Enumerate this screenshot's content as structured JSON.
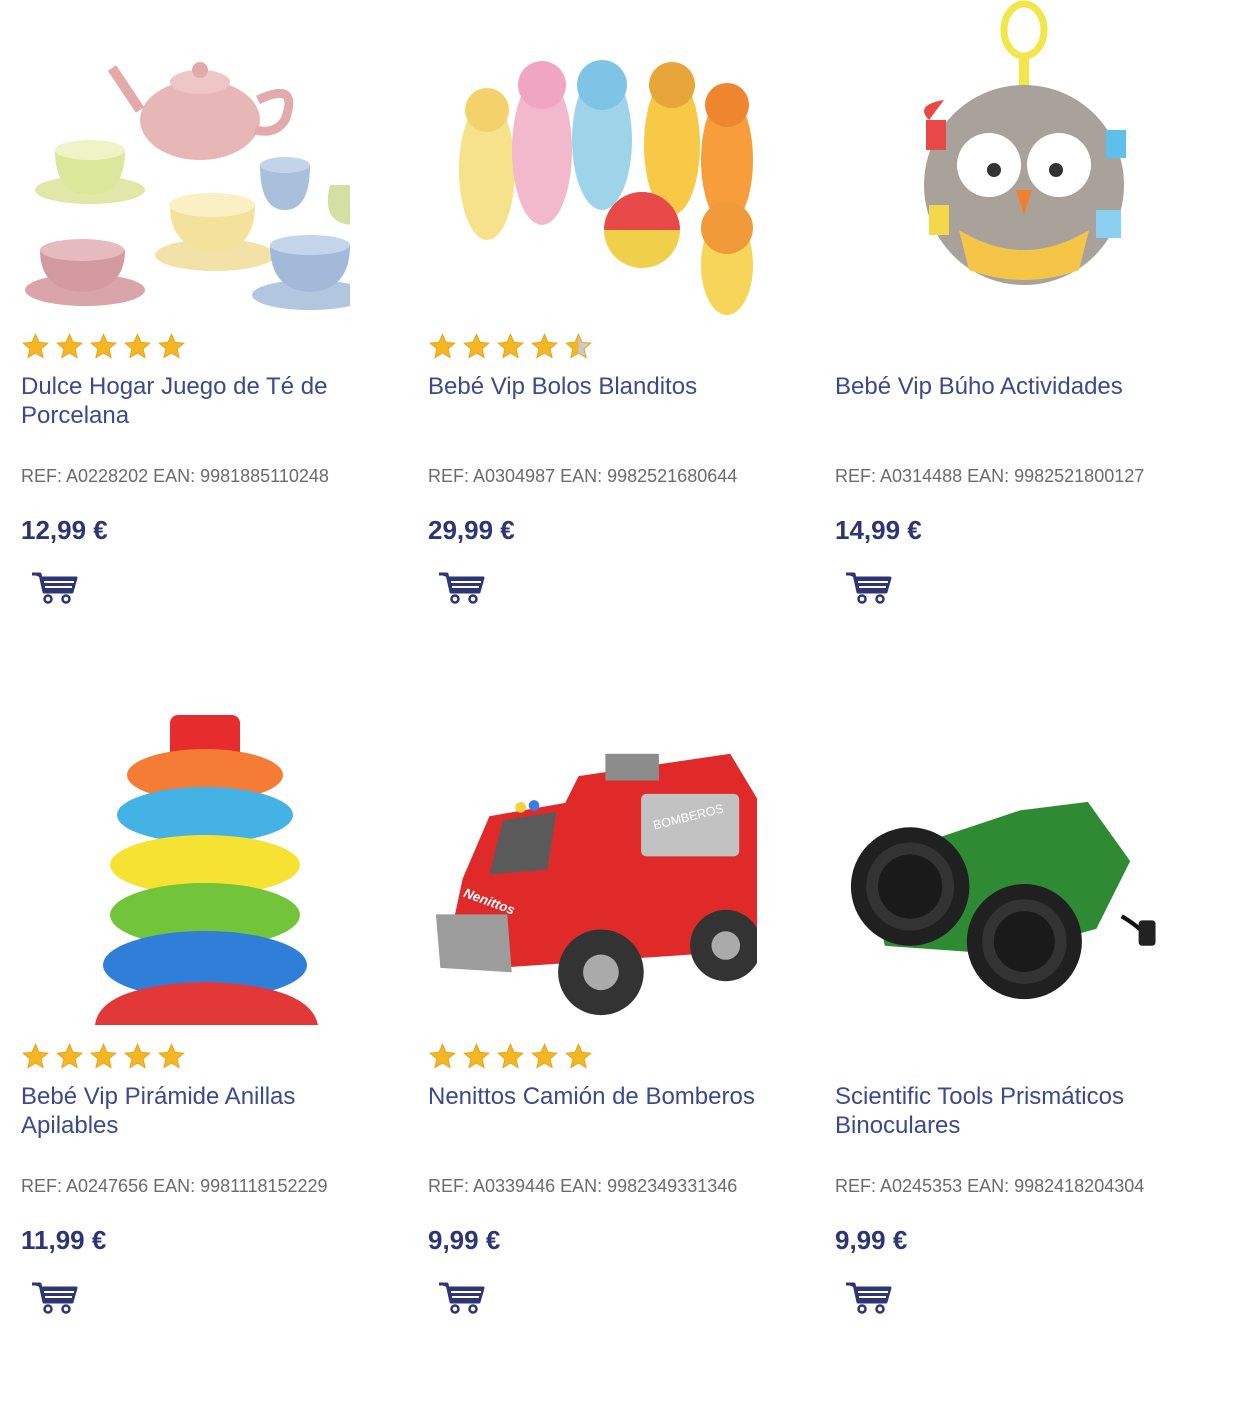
{
  "colors": {
    "title": "#3b4a8c",
    "price": "#2e3574",
    "ref": "#6b6b6b",
    "star": "#f5b623",
    "star_empty": "#c9c9c9",
    "cart": "#2e3574"
  },
  "products": [
    {
      "title": "Dulce Hogar Juego de Té de Porcelana",
      "ref": "REF: A0228202 EAN: 9981885110248",
      "price": "12,99 €",
      "rating": 5,
      "image_icon": "tea-set-image",
      "cart_icon": "shopping-cart-icon"
    },
    {
      "title": "Bebé Vip Bolos Blanditos",
      "ref": "REF: A0304987 EAN: 9982521680644",
      "price": "29,99 €",
      "rating": 4.5,
      "image_icon": "soft-bowling-image",
      "cart_icon": "shopping-cart-icon"
    },
    {
      "title": "Bebé Vip Búho Actividades",
      "ref": "REF: A0314488 EAN: 9982521800127",
      "price": "14,99 €",
      "rating": 0,
      "image_icon": "owl-toy-image",
      "cart_icon": "shopping-cart-icon"
    },
    {
      "title": "Bebé Vip Pirámide Anillas Apilables",
      "ref": "REF: A0247656 EAN: 9981118152229",
      "price": "11,99 €",
      "rating": 5,
      "image_icon": "ring-stacker-image",
      "cart_icon": "shopping-cart-icon"
    },
    {
      "title": "Nenittos Camión de Bomberos",
      "ref": "REF: A0339446 EAN: 9982349331346",
      "price": "9,99 €",
      "rating": 5,
      "image_icon": "fire-truck-image",
      "cart_icon": "shopping-cart-icon"
    },
    {
      "title": "Scientific Tools Prismáticos Binoculares",
      "ref": "REF: A0245353 EAN: 9982418204304",
      "price": "9,99 €",
      "rating": 0,
      "image_icon": "binoculars-image",
      "cart_icon": "shopping-cart-icon"
    }
  ],
  "image_labels": {
    "truck_side": "BOMBEROS",
    "truck_brand": "Nenittos"
  }
}
